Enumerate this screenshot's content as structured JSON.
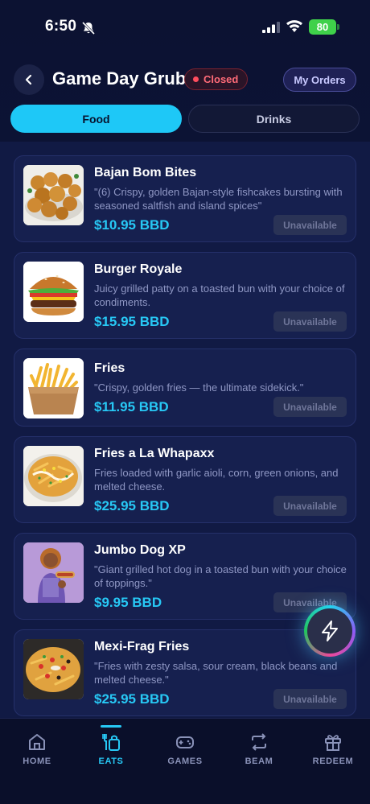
{
  "status_bar": {
    "time": "6:50",
    "battery": "80"
  },
  "header": {
    "title": "Game Day Grub",
    "status_badge": "Closed",
    "orders_button": "My Orders"
  },
  "tabs": [
    {
      "label": "Food",
      "active": true
    },
    {
      "label": "Drinks",
      "active": false
    }
  ],
  "menu_items": [
    {
      "name": "Bajan Bom Bites",
      "description": "\"(6) Crispy, golden Bajan-style fishcakes bursting with seasoned saltfish and island spices\"",
      "price": "$10.95 BBD",
      "availability": "Unavailable"
    },
    {
      "name": "Burger Royale",
      "description": "Juicy grilled patty on a toasted bun with your choice of condiments.",
      "price": "$15.95 BBD",
      "availability": "Unavailable"
    },
    {
      "name": "Fries",
      "description": "\"Crispy, golden fries — the ultimate sidekick.\"",
      "price": "$11.95 BBD",
      "availability": "Unavailable"
    },
    {
      "name": "Fries a La Whapaxx",
      "description": "Fries loaded with garlic aioli, corn, green onions, and melted cheese.",
      "price": "$25.95 BBD",
      "availability": "Unavailable"
    },
    {
      "name": "Jumbo Dog XP",
      "description": "\"Giant grilled hot dog in a toasted bun with your choice of toppings.\"",
      "price": "$9.95 BBD",
      "availability": "Unavailable"
    },
    {
      "name": "Mexi-Frag Fries",
      "description": "\"Fries with zesty salsa, sour cream, black beans and melted cheese.\"",
      "price": "$25.95 BBD",
      "availability": "Unavailable"
    }
  ],
  "bottom_nav": [
    {
      "label": "HOME",
      "icon": "home-icon",
      "active": false
    },
    {
      "label": "EATS",
      "icon": "eats-icon",
      "active": true
    },
    {
      "label": "GAMES",
      "icon": "gamepad-icon",
      "active": false
    },
    {
      "label": "BEAM",
      "icon": "beam-icon",
      "active": false
    },
    {
      "label": "REDEEM",
      "icon": "gift-icon",
      "active": false
    }
  ],
  "colors": {
    "accent": "#27c8f5",
    "background": "#0c1232",
    "closed": "#ff4d5e"
  }
}
